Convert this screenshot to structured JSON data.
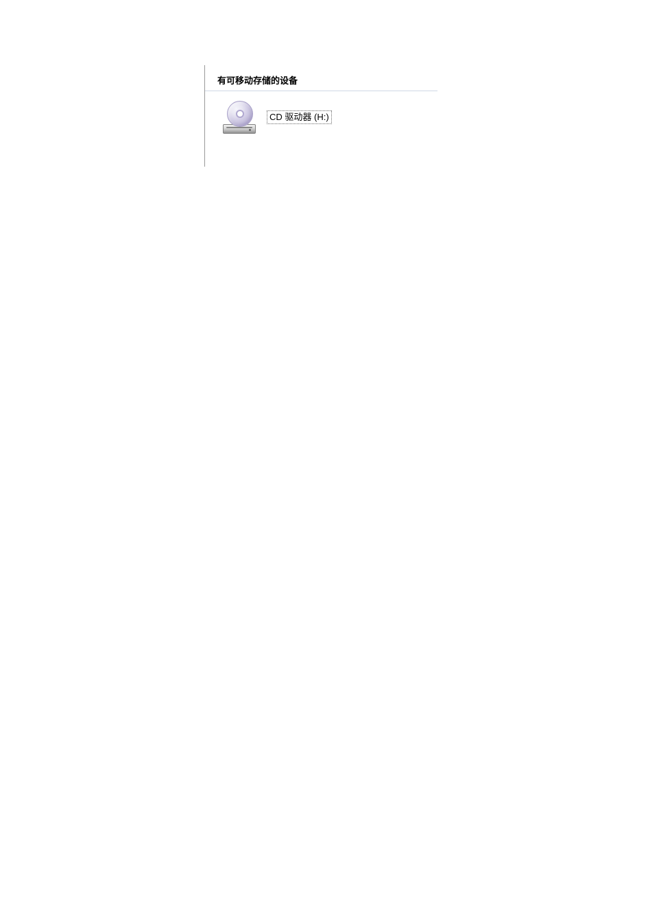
{
  "section": {
    "header": "有可移动存储的设备",
    "drives": [
      {
        "label": "CD 驱动器 (H:)",
        "icon": "cd-drive"
      }
    ]
  }
}
